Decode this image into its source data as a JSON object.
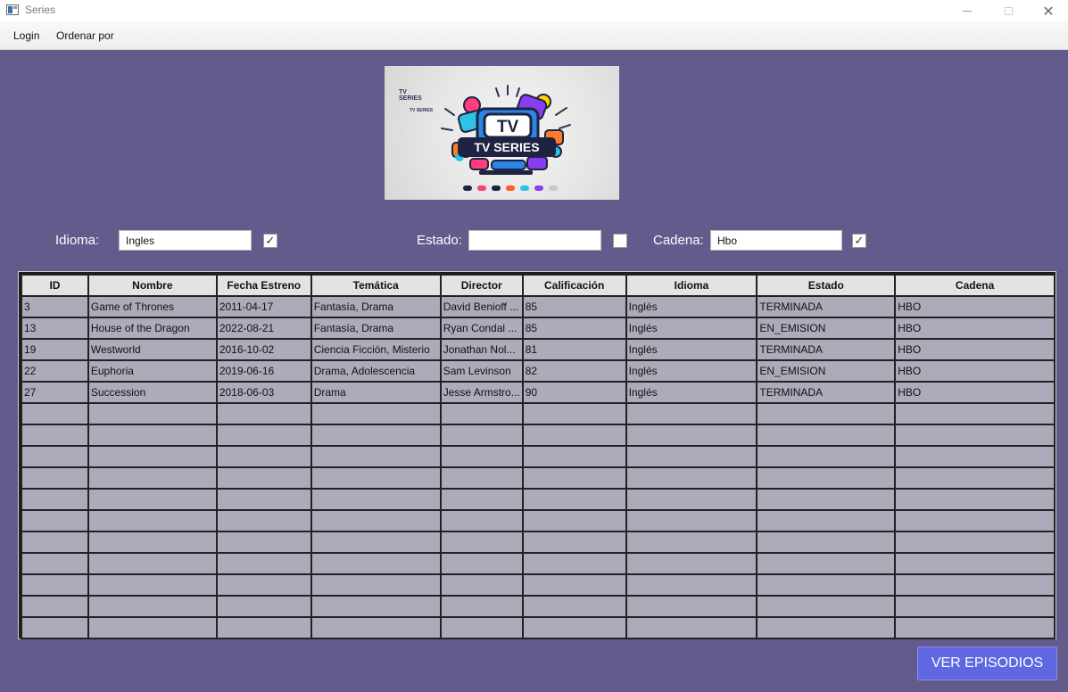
{
  "window": {
    "title": "Series"
  },
  "menu": {
    "login": "Login",
    "ordenar": "Ordenar por"
  },
  "banner": {
    "small_title": "TV SERIES",
    "small_sub": "TV SERIES",
    "tv": "TV",
    "main": "TV SERIES"
  },
  "filters": {
    "idioma": {
      "label": "Idioma:",
      "value": "Ingles",
      "checked": true
    },
    "estado": {
      "label": "Estado:",
      "value": "",
      "checked": false
    },
    "cadena": {
      "label": "Cadena:",
      "value": "Hbo",
      "checked": true
    }
  },
  "table": {
    "columns": [
      "ID",
      "Nombre",
      "Fecha Estreno",
      "Temática",
      "Director",
      "Calificación",
      "Idioma",
      "Estado",
      "Cadena"
    ],
    "rows": [
      [
        "3",
        "Game of Thrones",
        "2011-04-17",
        "Fantasía, Drama",
        "David Benioff ...",
        "85",
        "Inglés",
        "TERMINADA",
        "HBO"
      ],
      [
        "13",
        "House of the Dragon",
        "2022-08-21",
        "Fantasía, Drama",
        "Ryan Condal ...",
        "85",
        "Inglés",
        "EN_EMISION",
        "HBO"
      ],
      [
        "19",
        "Westworld",
        "2016-10-02",
        "Ciencia Ficción, Misterio",
        "Jonathan Nol...",
        "81",
        "Inglés",
        "TERMINADA",
        "HBO"
      ],
      [
        "22",
        "Euphoria",
        "2019-06-16",
        "Drama, Adolescencia",
        "Sam Levinson",
        "82",
        "Inglés",
        "EN_EMISION",
        "HBO"
      ],
      [
        "27",
        "Succession",
        "2018-06-03",
        "Drama",
        "Jesse Armstro...",
        "90",
        "Inglés",
        "TERMINADA",
        "HBO"
      ]
    ],
    "empty_rows": 11
  },
  "buttons": {
    "ver_episodios": "VER EPISODIOS"
  },
  "colors": {
    "background": "#625b8c",
    "row": "#aeaaba",
    "header": "#e3e3e3",
    "button": "#5f68e0"
  },
  "icons": {
    "app": "window-icon",
    "check": "checkmark-icon"
  }
}
